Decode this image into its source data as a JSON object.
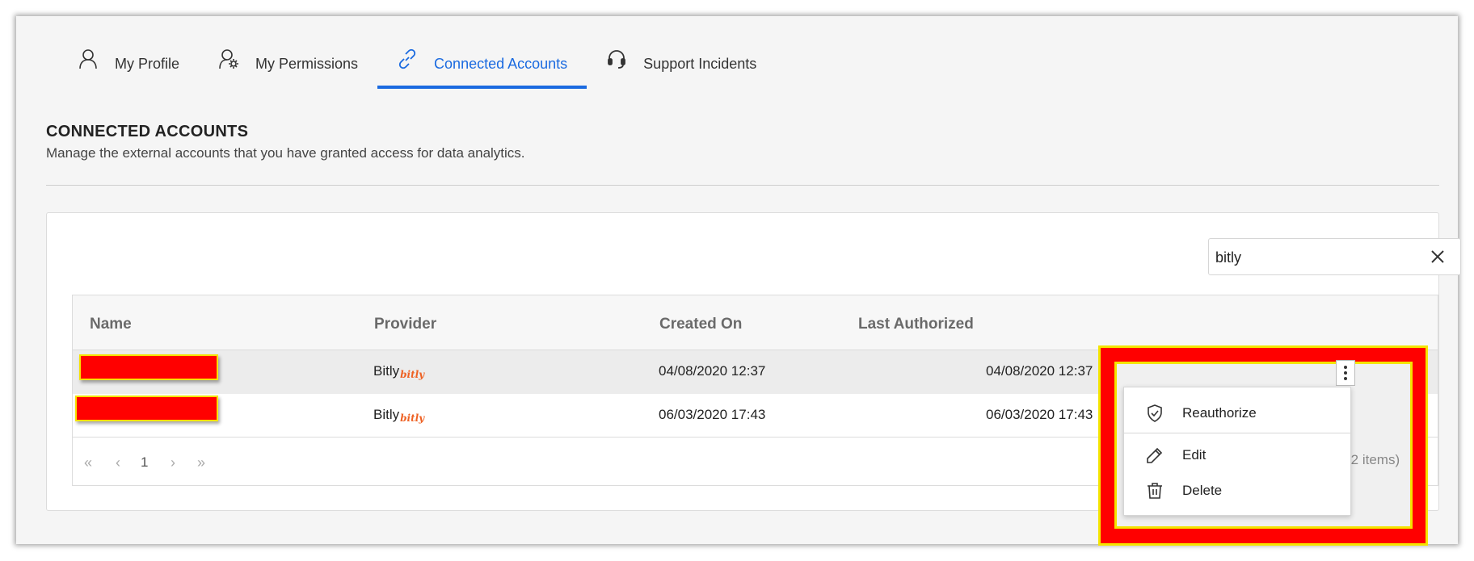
{
  "tabs": [
    {
      "label": "My Profile",
      "icon": "user-icon",
      "active": false
    },
    {
      "label": "My Permissions",
      "icon": "user-gear-icon",
      "active": false
    },
    {
      "label": "Connected Accounts",
      "icon": "link-icon",
      "active": true
    },
    {
      "label": "Support Incidents",
      "icon": "headset-icon",
      "active": false
    }
  ],
  "colors": {
    "accent": "#1a6ae0",
    "highlight": "#ff0000",
    "highlight_border": "#f4e400",
    "bitly": "#ee6123"
  },
  "section": {
    "title": "CONNECTED ACCOUNTS",
    "description": "Manage the external accounts that you have granted access for data analytics."
  },
  "search": {
    "value": "bitly",
    "clear_icon": "close-icon"
  },
  "grid": {
    "columns": [
      "Name",
      "Provider",
      "Created On",
      "Last Authorized"
    ],
    "rows": [
      {
        "name": "",
        "provider": "Bitly",
        "provider_logo": "bitly",
        "created_on": "04/08/2020 12:37",
        "last_authorized": "04/08/2020 12:37"
      },
      {
        "name": "",
        "provider": "Bitly",
        "provider_logo": "bitly",
        "created_on": "06/03/2020 17:43",
        "last_authorized": "06/03/2020 17:43"
      }
    ],
    "pager": {
      "current_page": "1",
      "count_text": "(2 items)"
    }
  },
  "context_menu": {
    "items": [
      {
        "label": "Reauthorize",
        "icon": "shield-check-icon"
      },
      {
        "label": "Edit",
        "icon": "pencil-icon"
      },
      {
        "label": "Delete",
        "icon": "trash-icon"
      }
    ]
  }
}
